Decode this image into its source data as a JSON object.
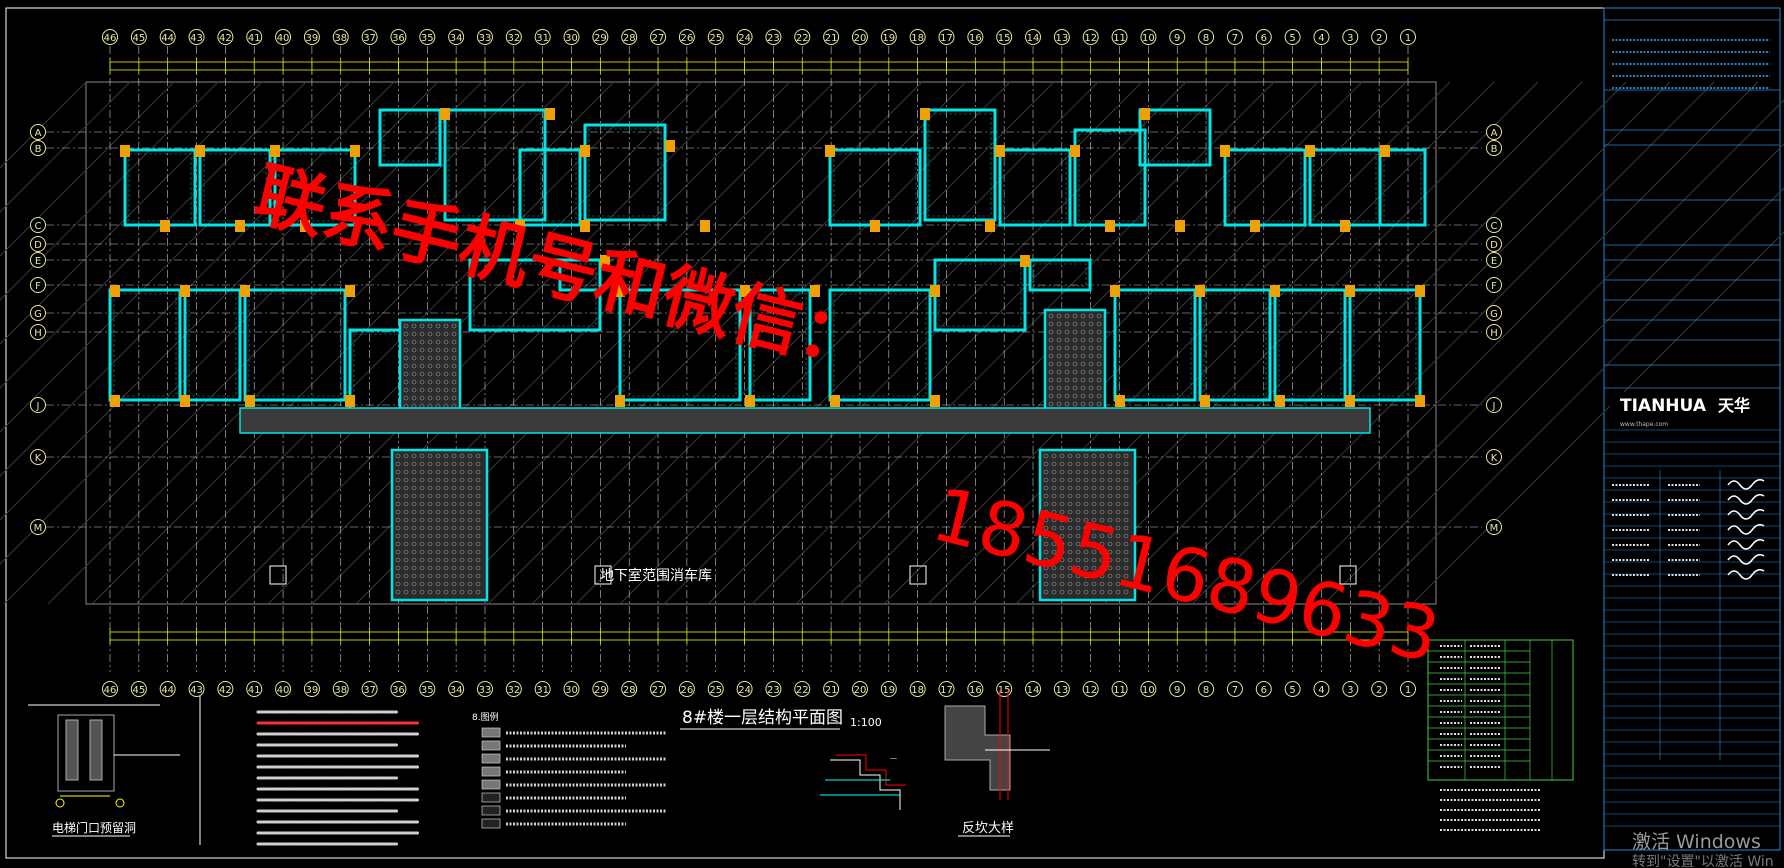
{
  "grid_top_labels": [
    "46",
    "45",
    "44",
    "43",
    "42",
    "41",
    "40",
    "39",
    "38",
    "37",
    "36",
    "35",
    "34",
    "33",
    "32",
    "31",
    "30",
    "29",
    "28",
    "27",
    "26",
    "25",
    "24",
    "23",
    "22",
    "21",
    "20",
    "19",
    "18",
    "17",
    "16",
    "15",
    "14",
    "13",
    "12",
    "11",
    "10",
    "9",
    "8",
    "7",
    "6",
    "5",
    "4",
    "3",
    "2",
    "1"
  ],
  "grid_side_labels": [
    "A",
    "B",
    "C",
    "D",
    "E",
    "F",
    "G",
    "H",
    "J",
    "K",
    "M"
  ],
  "watermark": {
    "line1": "联系手机号和微信：",
    "line2": "18551689633"
  },
  "plan": {
    "title": "8#楼一层结构平面图",
    "scale": "1:100",
    "garage_label": "地下室范围消车库"
  },
  "details": {
    "elevator_pit_title": "电梯门口预留洞",
    "fanban_title": "反坎大样"
  },
  "notes": {
    "heading_legend": "8.图例"
  },
  "titleblock": {
    "company_en": "TIANHUA",
    "company_cn": "天华",
    "website": "www.thape.com"
  },
  "os_overlay": {
    "line1": "激活 Windows",
    "line2": "转到\"设置\"以激活 Win"
  },
  "colors": {
    "background": "#000000",
    "grid_line": "#ffffff",
    "bubble": "#e8e8a0",
    "wall": "#00e5e5",
    "column": "#f0a000",
    "hatch": "#888888",
    "red": "#ff0000",
    "frame": "#ffffff",
    "dim": "#ffff00"
  }
}
